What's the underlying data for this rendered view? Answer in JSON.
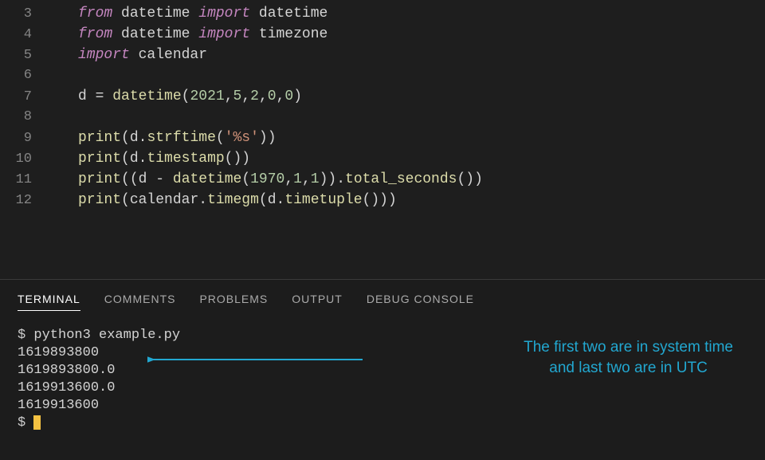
{
  "code_lines": [
    {
      "num": 3,
      "tokens": [
        {
          "t": "kw-import",
          "v": "from"
        },
        {
          "t": "sp",
          "v": " "
        },
        {
          "t": "ident",
          "v": "datetime"
        },
        {
          "t": "sp",
          "v": " "
        },
        {
          "t": "kw-import",
          "v": "import"
        },
        {
          "t": "sp",
          "v": " "
        },
        {
          "t": "ident",
          "v": "datetime"
        }
      ]
    },
    {
      "num": 4,
      "tokens": [
        {
          "t": "kw-import",
          "v": "from"
        },
        {
          "t": "sp",
          "v": " "
        },
        {
          "t": "ident",
          "v": "datetime"
        },
        {
          "t": "sp",
          "v": " "
        },
        {
          "t": "kw-import",
          "v": "import"
        },
        {
          "t": "sp",
          "v": " "
        },
        {
          "t": "ident",
          "v": "timezone"
        }
      ]
    },
    {
      "num": 5,
      "tokens": [
        {
          "t": "kw-import",
          "v": "import"
        },
        {
          "t": "sp",
          "v": " "
        },
        {
          "t": "ident",
          "v": "calendar"
        }
      ]
    },
    {
      "num": 6,
      "tokens": []
    },
    {
      "num": 7,
      "tokens": [
        {
          "t": "ident",
          "v": "d"
        },
        {
          "t": "sp",
          "v": " "
        },
        {
          "t": "op",
          "v": "="
        },
        {
          "t": "sp",
          "v": " "
        },
        {
          "t": "func",
          "v": "datetime"
        },
        {
          "t": "punct",
          "v": "("
        },
        {
          "t": "num",
          "v": "2021"
        },
        {
          "t": "punct",
          "v": ","
        },
        {
          "t": "num",
          "v": "5"
        },
        {
          "t": "punct",
          "v": ","
        },
        {
          "t": "num",
          "v": "2"
        },
        {
          "t": "punct",
          "v": ","
        },
        {
          "t": "num",
          "v": "0"
        },
        {
          "t": "punct",
          "v": ","
        },
        {
          "t": "num",
          "v": "0"
        },
        {
          "t": "punct",
          "v": ")"
        }
      ]
    },
    {
      "num": 8,
      "tokens": []
    },
    {
      "num": 9,
      "tokens": [
        {
          "t": "func",
          "v": "print"
        },
        {
          "t": "punct",
          "v": "("
        },
        {
          "t": "ident",
          "v": "d"
        },
        {
          "t": "punct",
          "v": "."
        },
        {
          "t": "func",
          "v": "strftime"
        },
        {
          "t": "punct",
          "v": "("
        },
        {
          "t": "str",
          "v": "'%s'"
        },
        {
          "t": "punct",
          "v": ")"
        },
        {
          "t": "punct",
          "v": ")"
        }
      ]
    },
    {
      "num": 10,
      "tokens": [
        {
          "t": "func",
          "v": "print"
        },
        {
          "t": "punct",
          "v": "("
        },
        {
          "t": "ident",
          "v": "d"
        },
        {
          "t": "punct",
          "v": "."
        },
        {
          "t": "func",
          "v": "timestamp"
        },
        {
          "t": "punct",
          "v": "("
        },
        {
          "t": "punct",
          "v": ")"
        },
        {
          "t": "punct",
          "v": ")"
        }
      ]
    },
    {
      "num": 11,
      "tokens": [
        {
          "t": "func",
          "v": "print"
        },
        {
          "t": "punct",
          "v": "("
        },
        {
          "t": "punct",
          "v": "("
        },
        {
          "t": "ident",
          "v": "d"
        },
        {
          "t": "sp",
          "v": " "
        },
        {
          "t": "op",
          "v": "-"
        },
        {
          "t": "sp",
          "v": " "
        },
        {
          "t": "func",
          "v": "datetime"
        },
        {
          "t": "punct",
          "v": "("
        },
        {
          "t": "num",
          "v": "1970"
        },
        {
          "t": "punct",
          "v": ","
        },
        {
          "t": "num",
          "v": "1"
        },
        {
          "t": "punct",
          "v": ","
        },
        {
          "t": "num",
          "v": "1"
        },
        {
          "t": "punct",
          "v": ")"
        },
        {
          "t": "punct",
          "v": ")"
        },
        {
          "t": "punct",
          "v": "."
        },
        {
          "t": "func",
          "v": "total_seconds"
        },
        {
          "t": "punct",
          "v": "("
        },
        {
          "t": "punct",
          "v": ")"
        },
        {
          "t": "punct",
          "v": ")"
        }
      ]
    },
    {
      "num": 12,
      "tokens": [
        {
          "t": "func",
          "v": "print"
        },
        {
          "t": "punct",
          "v": "("
        },
        {
          "t": "ident",
          "v": "calendar"
        },
        {
          "t": "punct",
          "v": "."
        },
        {
          "t": "func",
          "v": "timegm"
        },
        {
          "t": "punct",
          "v": "("
        },
        {
          "t": "ident",
          "v": "d"
        },
        {
          "t": "punct",
          "v": "."
        },
        {
          "t": "func",
          "v": "timetuple"
        },
        {
          "t": "punct",
          "v": "("
        },
        {
          "t": "punct",
          "v": ")"
        },
        {
          "t": "punct",
          "v": ")"
        },
        {
          "t": "punct",
          "v": ")"
        }
      ]
    }
  ],
  "panel": {
    "tabs": [
      {
        "label": "TERMINAL",
        "active": true
      },
      {
        "label": "COMMENTS",
        "active": false
      },
      {
        "label": "PROBLEMS",
        "active": false
      },
      {
        "label": "OUTPUT",
        "active": false
      },
      {
        "label": "DEBUG CONSOLE",
        "active": false
      }
    ],
    "terminal": {
      "prompt_symbol": "$",
      "command": "python3 example.py",
      "output_lines": [
        "1619893800",
        "1619893800.0",
        "1619913600.0",
        "1619913600"
      ]
    },
    "annotation": {
      "line1": "The first two are in system time",
      "line2": "and last two are in UTC"
    }
  }
}
